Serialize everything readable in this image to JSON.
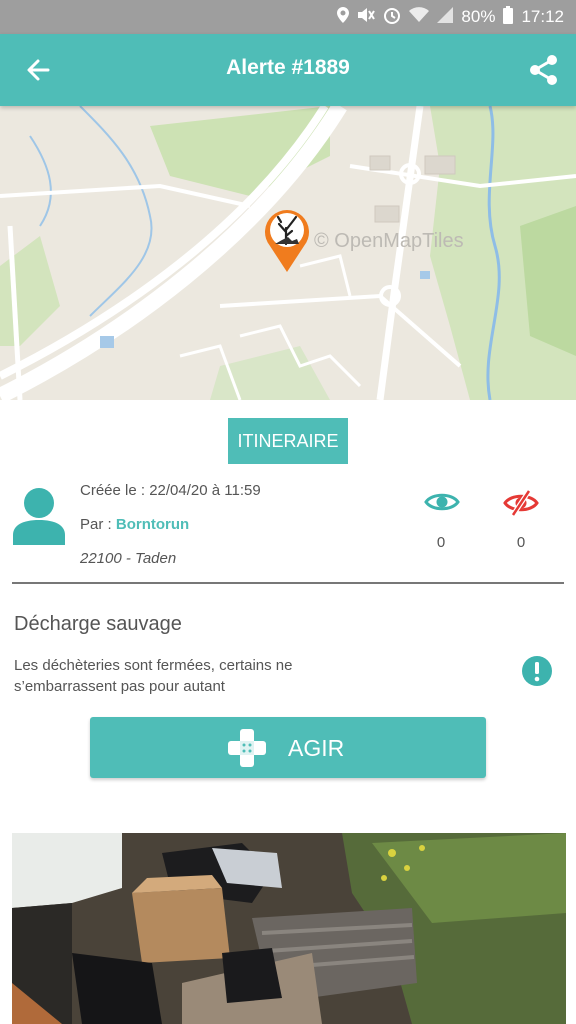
{
  "status_bar": {
    "battery": "80%",
    "time": "17:12",
    "icons": [
      "location-icon",
      "mute-icon",
      "alarm-icon",
      "wifi-icon",
      "signal-icon",
      "battery-icon"
    ]
  },
  "header": {
    "title": "Alerte #1889",
    "back_icon": "arrow-left-icon",
    "share_icon": "share-icon"
  },
  "map": {
    "attribution": "© OpenMapTiles",
    "marker_icon": "dead-tree-pollution-icon"
  },
  "itinerary": {
    "label": "ITINERAIRE"
  },
  "report": {
    "created": "Créée le : 22/04/20 à 11:59",
    "author_prefix": "Par :",
    "author": "Borntorun",
    "location": "22100 - Taden",
    "views": "0",
    "hidden": "0"
  },
  "alert": {
    "title": "Décharge sauvage",
    "description": "Les déchèteries sont fermées, certains ne s’embarrassent pas pour autant"
  },
  "action": {
    "label": "AGIR"
  },
  "colors": {
    "accent": "#4fbdb7",
    "status_bar": "#9e9e9e",
    "danger": "#e53935",
    "marker": "#f07c1e"
  }
}
